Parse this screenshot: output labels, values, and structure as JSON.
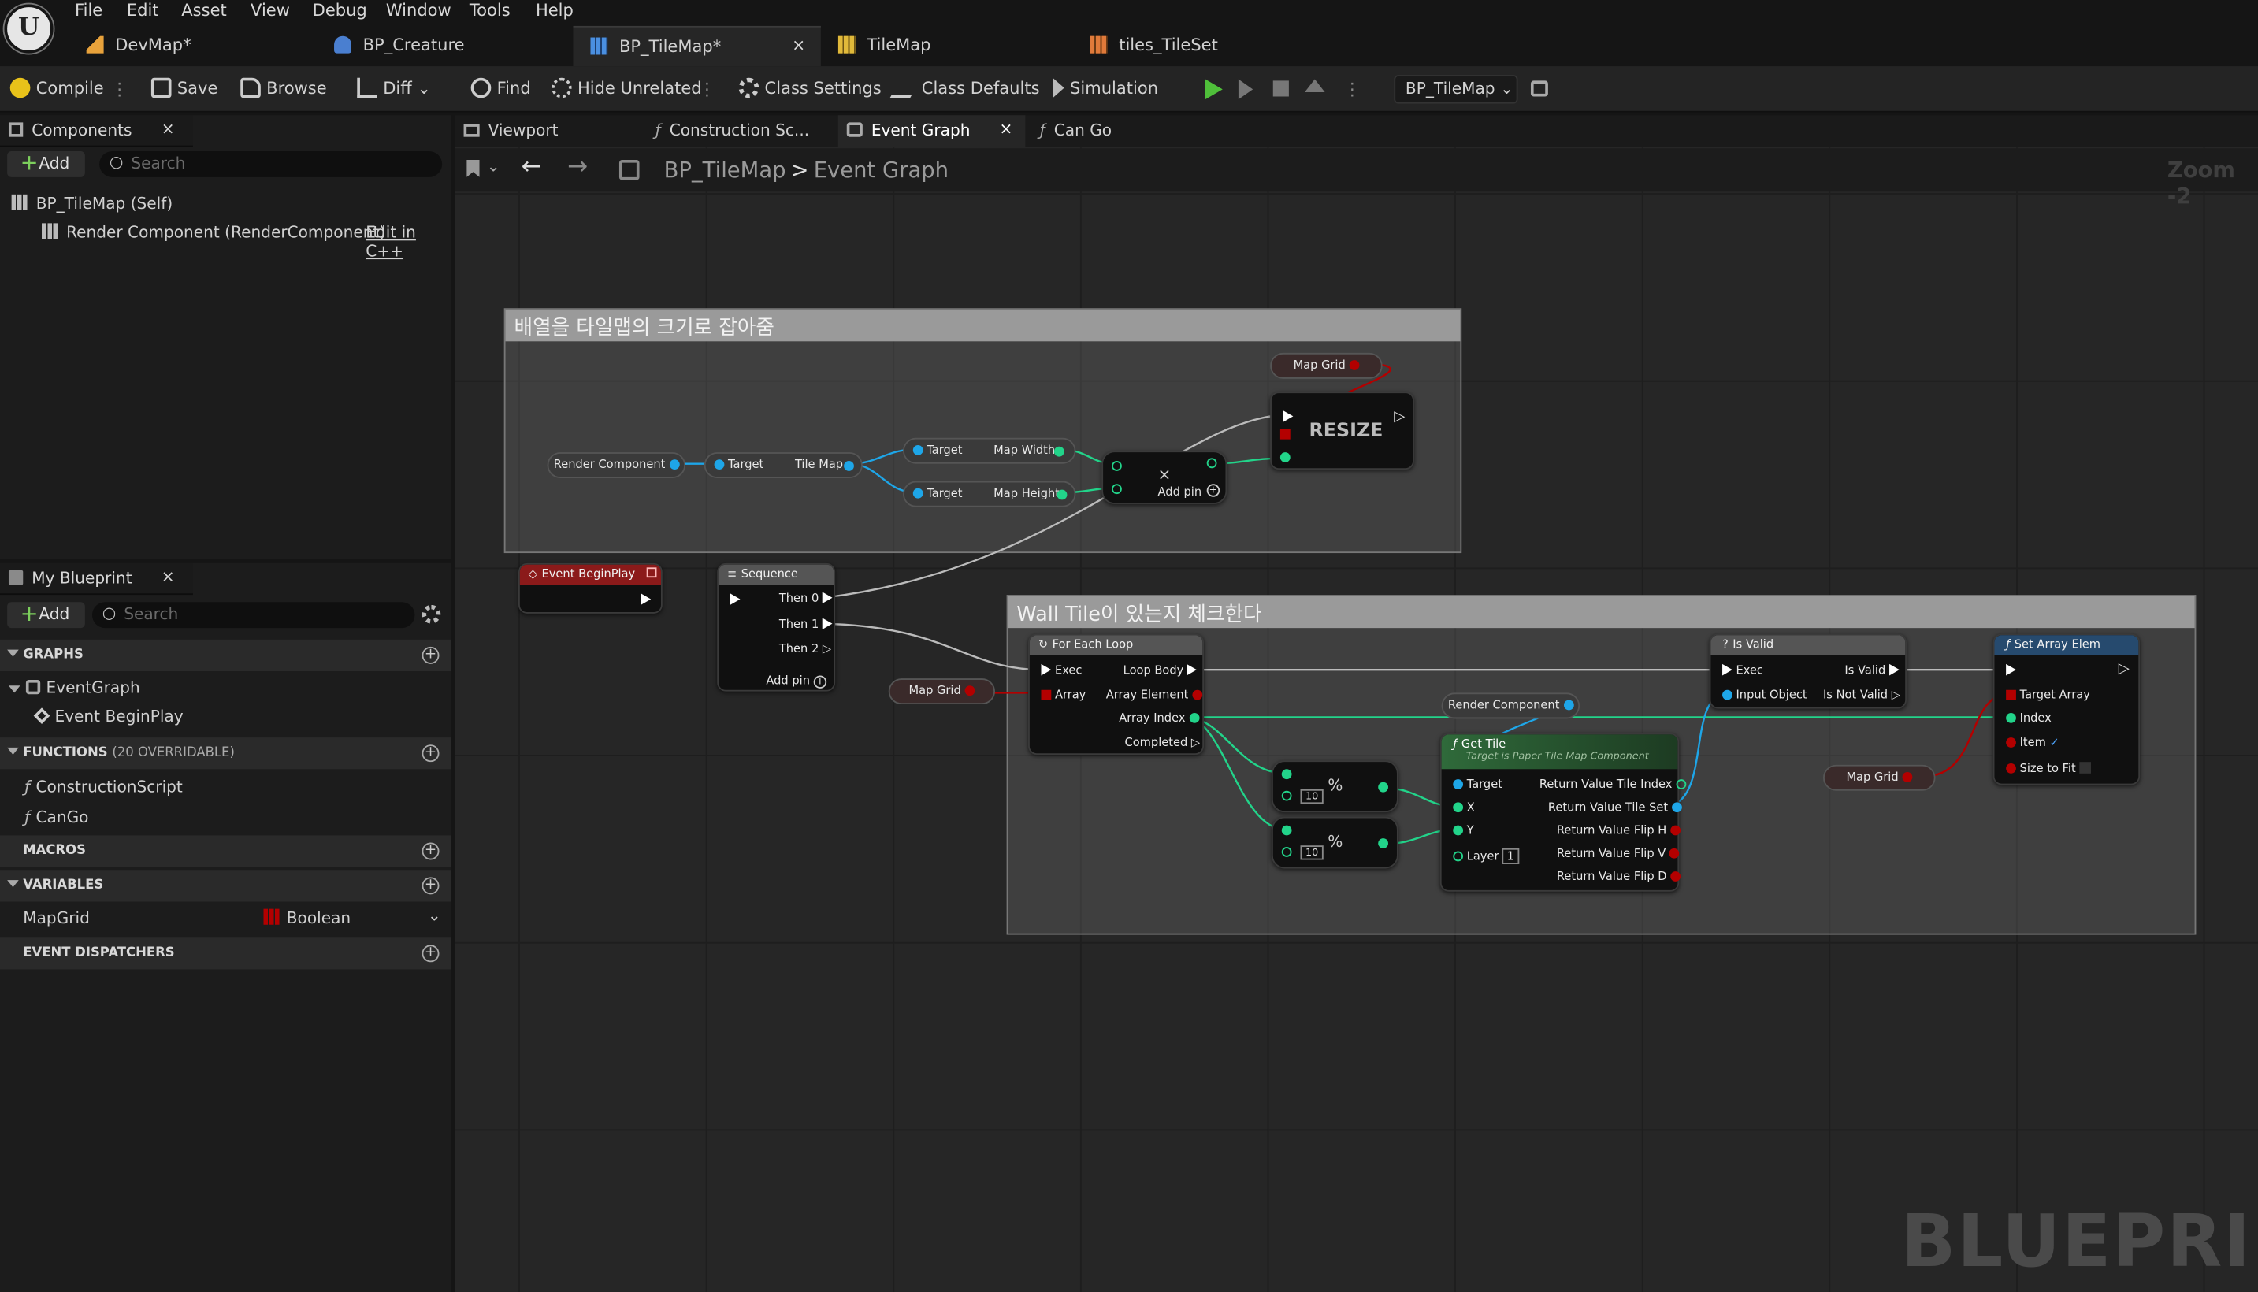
{
  "menu": [
    "File",
    "Edit",
    "Asset",
    "View",
    "Debug",
    "Window",
    "Tools",
    "Help"
  ],
  "doc_tabs": [
    {
      "label": "DevMap*",
      "icon": "level-icon"
    },
    {
      "label": "BP_Creature",
      "icon": "character-icon"
    },
    {
      "label": "BP_TileMap*",
      "icon": "tilemap-icon",
      "active": true
    },
    {
      "label": "TileMap",
      "icon": "tilemap-asset-icon"
    },
    {
      "label": "tiles_TileSet",
      "icon": "tileset-icon"
    }
  ],
  "toolbar": {
    "compile": "Compile",
    "save": "Save",
    "browse": "Browse",
    "diff": "Diff",
    "find": "Find",
    "hide_unrelated": "Hide Unrelated",
    "class_settings": "Class Settings",
    "class_defaults": "Class Defaults",
    "simulation": "Simulation",
    "debug_object": "BP_TileMap"
  },
  "components": {
    "title": "Components",
    "add": "Add",
    "search_placeholder": "Search",
    "self": "BP_TileMap (Self)",
    "render": "Render Component (RenderComponent)",
    "edit_cpp": "Edit in C++"
  },
  "my_blueprint": {
    "title": "My Blueprint",
    "add": "Add",
    "search_placeholder": "Search",
    "graphs_label": "GRAPHS",
    "event_graph": "EventGraph",
    "event_beginplay": "Event BeginPlay",
    "functions_label": "FUNCTIONS",
    "functions_count": "(20 OVERRIDABLE)",
    "functions": [
      "ConstructionScript",
      "CanGo"
    ],
    "macros_label": "MACROS",
    "variables_label": "VARIABLES",
    "var_name": "MapGrid",
    "var_type": "Boolean",
    "dispatchers_label": "EVENT DISPATCHERS"
  },
  "graph_tabs": [
    "Viewport",
    "Construction Sc...",
    "Event Graph",
    "Can Go"
  ],
  "breadcrumb": {
    "bp": "BP_TileMap",
    "graph": "Event Graph",
    "sep": ">"
  },
  "zoom": "Zoom -2",
  "watermark": "BLUEPRINT",
  "comments": {
    "c1": "배열을 타일맵의 크기로 잡아줌",
    "c2": "Wall Tile이 있는지 체크한다"
  },
  "nodes": {
    "map_grid": "Map Grid",
    "resize": "RESIZE",
    "render_component": "Render Component",
    "target": "Target",
    "tile_map": "Tile Map",
    "map_width": "Map Width",
    "map_height": "Map Height",
    "multiply": "×",
    "add_pin": "Add pin",
    "event_beginplay": "Event BeginPlay",
    "sequence": "Sequence",
    "then0": "Then 0",
    "then1": "Then 1",
    "then2": "Then 2",
    "for_each": "For Each Loop",
    "exec": "Exec",
    "array": "Array",
    "loop_body": "Loop Body",
    "array_element": "Array Element",
    "array_index": "Array Index",
    "completed": "Completed",
    "percent": "%",
    "mod_value": "10",
    "get_tile": "Get Tile",
    "get_tile_sub": "Target is Paper Tile Map Component",
    "x": "X",
    "y": "Y",
    "layer": "Layer",
    "layer_value": "1",
    "ret_index": "Return Value Tile Index",
    "ret_set": "Return Value Tile Set",
    "ret_fh": "Return Value Flip H",
    "ret_fv": "Return Value Flip V",
    "ret_fd": "Return Value Flip D",
    "is_valid": "Is Valid",
    "input_object": "Input Object",
    "is_valid_out": "Is Valid",
    "is_not_valid": "Is Not Valid",
    "set_array": "Set Array Elem",
    "target_array": "Target Array",
    "index": "Index",
    "item": "Item",
    "size_to_fit": "Size to Fit"
  }
}
